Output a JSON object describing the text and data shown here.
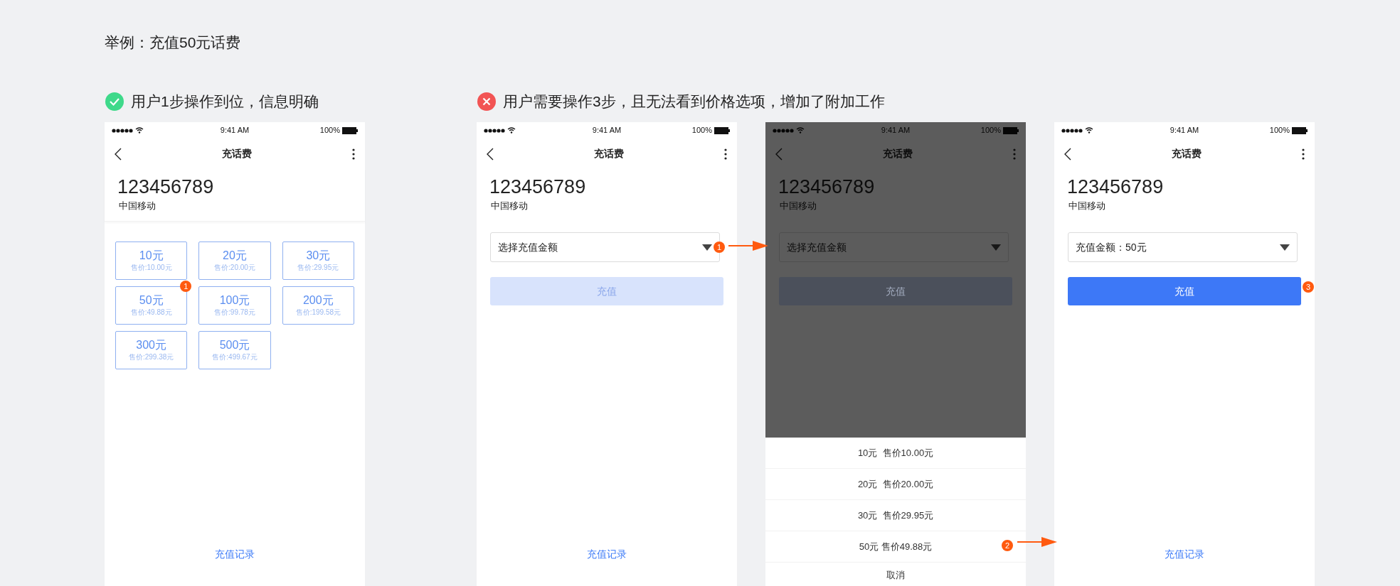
{
  "title": "举例：充值50元话费",
  "groups": [
    {
      "kind": "good",
      "heading": "用户1步操作到位，信息明确",
      "phones": [
        {
          "kind": "grid",
          "time": "9:41 AM",
          "battery": "100%",
          "nav_title": "充话费",
          "number": "123456789",
          "carrier": "中国移动",
          "options": [
            {
              "amount": "10元",
              "price": "售价:10.00元"
            },
            {
              "amount": "20元",
              "price": "售价:20.00元"
            },
            {
              "amount": "30元",
              "price": "售价:29.95元"
            },
            {
              "amount": "50元",
              "price": "售价:49.88元",
              "step": "1"
            },
            {
              "amount": "100元",
              "price": "售价:99.78元"
            },
            {
              "amount": "200元",
              "price": "售价:199.58元"
            },
            {
              "amount": "300元",
              "price": "售价:299.38元"
            },
            {
              "amount": "500元",
              "price": "售价:499.67元"
            }
          ],
          "footer": "充值记录"
        }
      ]
    },
    {
      "kind": "bad",
      "heading": "用户需要操作3步，且无法看到价格选项，增加了附加工作",
      "phones": [
        {
          "kind": "form",
          "dimmed": false,
          "time": "9:41 AM",
          "battery": "100%",
          "nav_title": "充话费",
          "number": "123456789",
          "carrier": "中国移动",
          "select": {
            "text": "选择充值金额",
            "step": "1"
          },
          "button": {
            "label": "充值",
            "disabled": true
          },
          "footer": "充值记录"
        },
        {
          "kind": "form",
          "dimmed": true,
          "time": "9:41 AM",
          "battery": "100%",
          "nav_title": "充话费",
          "number": "123456789",
          "carrier": "中国移动",
          "select": {
            "text": "选择充值金额"
          },
          "button": {
            "label": "充值",
            "disabled": true
          },
          "sheet": {
            "options": [
              {
                "text": "10元  售价10.00元"
              },
              {
                "text": "20元  售价20.00元"
              },
              {
                "text": "30元  售价29.95元"
              },
              {
                "text": "50元 售价49.88元",
                "step": "2"
              }
            ],
            "cancel": "取消"
          }
        },
        {
          "kind": "form",
          "dimmed": false,
          "time": "9:41 AM",
          "battery": "100%",
          "nav_title": "充话费",
          "number": "123456789",
          "carrier": "中国移动",
          "select": {
            "text": "充值金额：50元"
          },
          "button": {
            "label": "充值",
            "disabled": false,
            "step": "3"
          },
          "footer": "充值记录"
        }
      ]
    }
  ]
}
